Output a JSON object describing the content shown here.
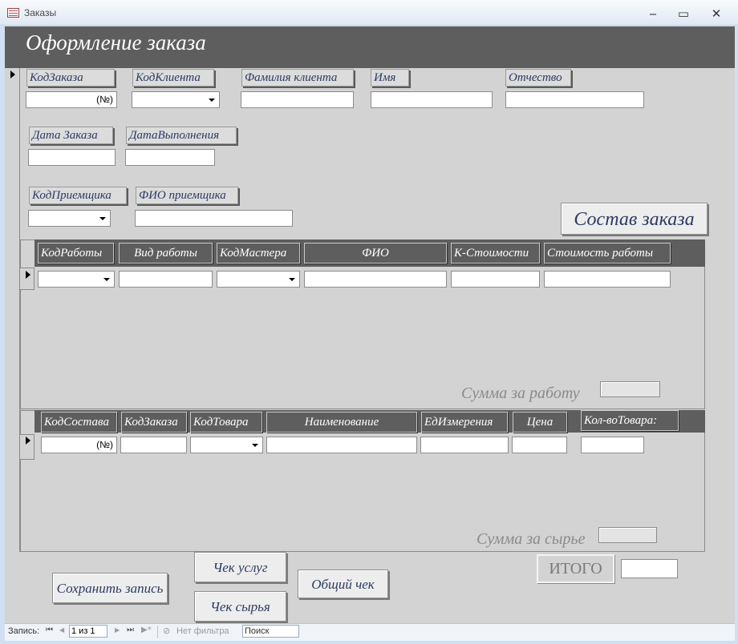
{
  "window": {
    "title": "Заказы",
    "minimize_glyph": "‒",
    "maximize_glyph": "▭",
    "close_glyph": "✕"
  },
  "form": {
    "title": "Оформление заказа"
  },
  "fields": {
    "order_id_label": "КодЗаказа",
    "order_id_value": "(№)",
    "client_id_label": "КодКлиента",
    "client_lastname_label": "Фамилия клиента",
    "first_name_label": "Имя",
    "patronymic_label": "Отчество",
    "order_date_label": "Дата Заказа",
    "completion_date_label": "ДатаВыполнения",
    "receiver_id_label": "КодПриемщика",
    "receiver_name_label": "ФИО приемщика"
  },
  "buttons": {
    "order_composition": "Состав заказа",
    "save_record": "Сохранить запись",
    "services_receipt": "Чек услуг",
    "materials_receipt": "Чек сырья",
    "total_receipt": "Общий чек"
  },
  "works_subform": {
    "columns": [
      "КодРаботы",
      "Вид работы",
      "КодМастера",
      "ФИО",
      "К-Стоимости",
      "Стоимость работы"
    ],
    "sum_label": "Сумма за работу"
  },
  "items_subform": {
    "columns": [
      "КодСостава",
      "КодЗаказа",
      "КодТовара",
      "Наименование",
      "ЕдИзмерения",
      "Цена",
      "Кол-воТовара:"
    ],
    "new_record_value": "(№)",
    "sum_label": "Сумма за сырье"
  },
  "total": {
    "label": "ИТОГО"
  },
  "navigation": {
    "record_label": "Запись:",
    "first_glyph": "⏮",
    "prev_glyph": "◀",
    "position": "1 из 1",
    "next_glyph": "▶",
    "last_glyph": "⏭",
    "new_glyph": "▶*",
    "filter_label": "Нет фильтра",
    "search_label": "Поиск"
  }
}
